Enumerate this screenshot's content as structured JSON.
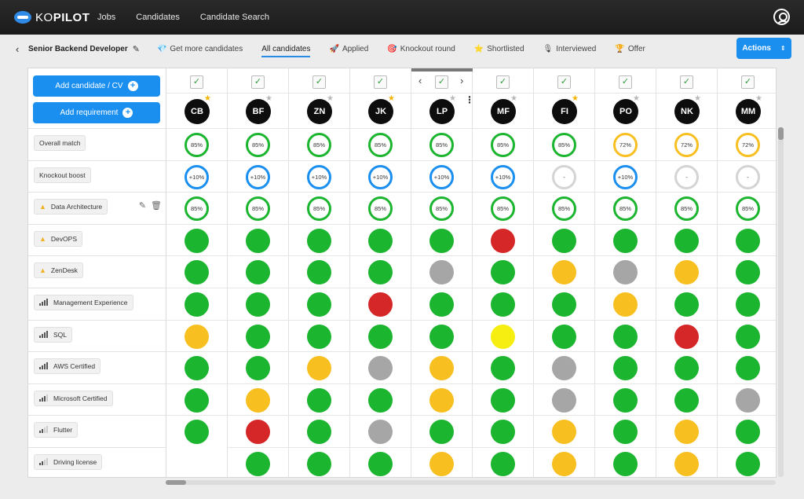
{
  "app": {
    "logo_ko": "KO",
    "logo_pilot": "PILOT"
  },
  "topnav": [
    "Jobs",
    "Candidates",
    "Candidate Search"
  ],
  "job": {
    "back": "‹",
    "title": "Senior Backend Developer",
    "edit": "✎"
  },
  "tabs": [
    {
      "icon": "💎",
      "label": "Get more candidates"
    },
    {
      "icon": "",
      "label": "All candidates",
      "active": true
    },
    {
      "icon": "🚀",
      "label": "Applied"
    },
    {
      "icon": "🎯",
      "label": "Knockout round"
    },
    {
      "icon": "⭐",
      "label": "Shortlisted"
    },
    {
      "icon": "🎙",
      "label": "Interviewed"
    },
    {
      "icon": "🏆",
      "label": "Offer"
    }
  ],
  "actions_label": "Actions",
  "actions_caret": "⇕",
  "left": {
    "add_candidate": "Add candidate / CV",
    "add_requirement": "Add requirement",
    "plus": "+"
  },
  "rows": [
    {
      "label": "Overall match",
      "kind": "plain"
    },
    {
      "label": "Knockout boost",
      "kind": "plain"
    },
    {
      "label": "Data Architecture",
      "kind": "warn",
      "tools": true
    },
    {
      "label": "DevOPS",
      "kind": "warn"
    },
    {
      "label": "ZenDesk",
      "kind": "warn"
    },
    {
      "label": "Management Experience",
      "kind": "bars",
      "level": 4
    },
    {
      "label": "SQL",
      "kind": "bars",
      "level": 4
    },
    {
      "label": "AWS Certified",
      "kind": "bars",
      "level": 4
    },
    {
      "label": "Microsoft Certified",
      "kind": "bars",
      "level": 3
    },
    {
      "label": "Flutter",
      "kind": "bars",
      "level": 2
    },
    {
      "label": "Driving license",
      "kind": "bars",
      "level": 2
    }
  ],
  "tools": {
    "edit": "✎",
    "trash": "🗑"
  },
  "check": "✓",
  "nav": {
    "prev": "‹",
    "next": "›",
    "more": "⋮"
  },
  "colors": {
    "green": "#1cb52f",
    "red": "#d62728",
    "amber": "#f8bf21",
    "yellow": "#f5ee10",
    "grey": "#a6a6a6",
    "blue": "#1a8ff0",
    "ring_grey": "#d4d4d4",
    "star_gold": "#f5b301",
    "star_grey": "#b8b8b8"
  },
  "candidates": [
    {
      "initials": "CB",
      "star": "gold",
      "match": {
        "text": "85%",
        "color": "green"
      },
      "boost": {
        "text": "+10%",
        "color": "blue"
      },
      "data_arch": "85%",
      "dots": [
        "green",
        "green",
        "green",
        "amber",
        "green",
        "green",
        "green"
      ]
    },
    {
      "initials": "BF",
      "star": "grey",
      "match": {
        "text": "85%",
        "color": "green"
      },
      "boost": {
        "text": "+10%",
        "color": "blue"
      },
      "data_arch": "85%",
      "dots": [
        "green",
        "green",
        "green",
        "green",
        "green",
        "amber",
        "red",
        "green"
      ]
    },
    {
      "initials": "ZN",
      "star": "grey",
      "match": {
        "text": "85%",
        "color": "green"
      },
      "boost": {
        "text": "+10%",
        "color": "blue"
      },
      "data_arch": "85%",
      "dots": [
        "green",
        "green",
        "green",
        "green",
        "amber",
        "green",
        "green",
        "green"
      ]
    },
    {
      "initials": "JK",
      "star": "gold",
      "match": {
        "text": "85%",
        "color": "green"
      },
      "boost": {
        "text": "+10%",
        "color": "blue"
      },
      "data_arch": "85%",
      "dots": [
        "green",
        "green",
        "red",
        "green",
        "grey",
        "green",
        "grey",
        "green"
      ]
    },
    {
      "initials": "LP",
      "star": "grey",
      "match": {
        "text": "85%",
        "color": "green"
      },
      "boost": {
        "text": "+10%",
        "color": "blue"
      },
      "data_arch": "85%",
      "dots": [
        "green",
        "grey",
        "green",
        "green",
        "amber",
        "amber",
        "green",
        "amber"
      ]
    },
    {
      "initials": "MF",
      "star": "grey",
      "match": {
        "text": "85%",
        "color": "green"
      },
      "boost": {
        "text": "+10%",
        "color": "blue"
      },
      "data_arch": "85%",
      "dots": [
        "red",
        "green",
        "green",
        "yellow",
        "green",
        "green",
        "green",
        "green"
      ]
    },
    {
      "initials": "FI",
      "star": "gold",
      "match": {
        "text": "85%",
        "color": "green"
      },
      "boost": {
        "text": "-",
        "color": "ring_grey"
      },
      "data_arch": "85%",
      "dots": [
        "green",
        "amber",
        "green",
        "green",
        "grey",
        "grey",
        "amber",
        "amber"
      ]
    },
    {
      "initials": "PO",
      "star": "grey",
      "match": {
        "text": "72%",
        "color": "amber"
      },
      "boost": {
        "text": "+10%",
        "color": "blue"
      },
      "data_arch": "85%",
      "dots": [
        "green",
        "grey",
        "amber",
        "green",
        "green",
        "green",
        "green",
        "green"
      ]
    },
    {
      "initials": "NK",
      "star": "grey",
      "match": {
        "text": "72%",
        "color": "amber"
      },
      "boost": {
        "text": "-",
        "color": "ring_grey"
      },
      "data_arch": "85%",
      "dots": [
        "green",
        "amber",
        "green",
        "red",
        "green",
        "green",
        "amber",
        "amber"
      ]
    },
    {
      "initials": "MM",
      "star": "grey",
      "match": {
        "text": "72%",
        "color": "amber"
      },
      "boost": {
        "text": "-",
        "color": "ring_grey"
      },
      "data_arch": "85%",
      "dots": [
        "green",
        "green",
        "green",
        "green",
        "green",
        "grey",
        "green",
        "green"
      ]
    }
  ]
}
